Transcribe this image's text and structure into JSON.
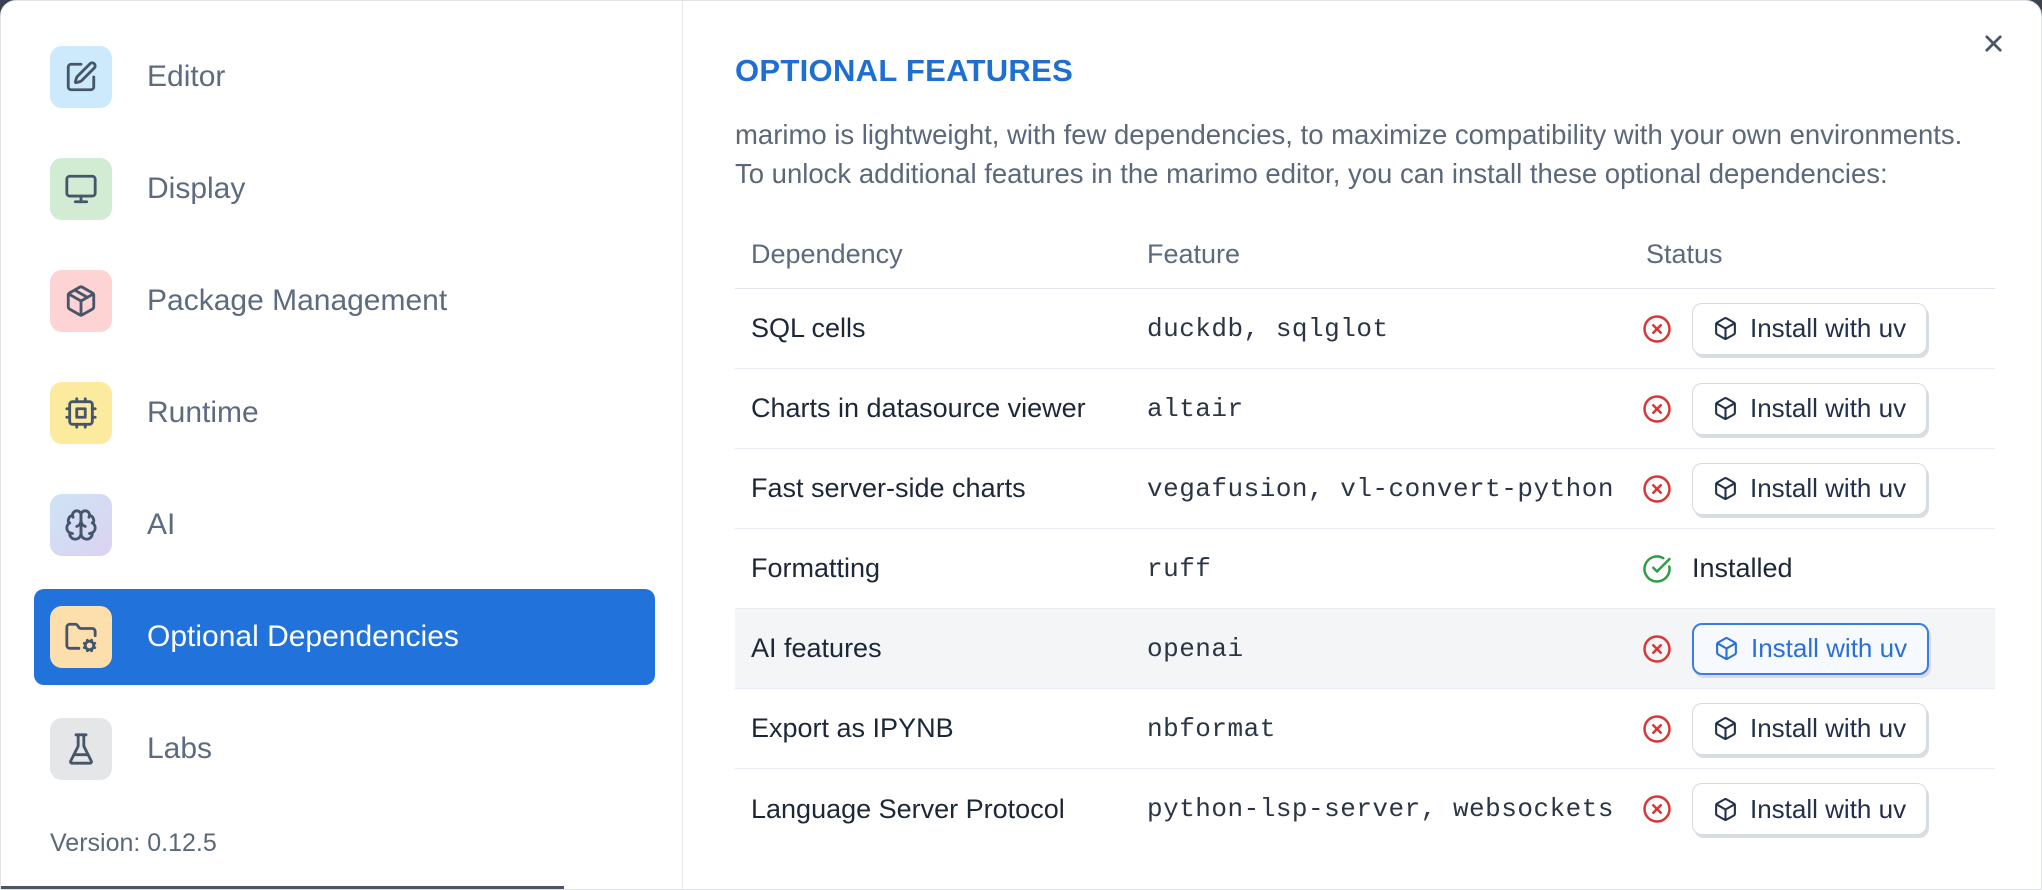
{
  "colors": {
    "accent": "#2173db",
    "title_blue": "#1d6fd2",
    "red": "#d93636",
    "green": "#2e9e44",
    "row_highlight": "#f4f5f7",
    "sidebar_border": "#e4e7ec"
  },
  "sidebar": {
    "items": [
      {
        "label": "Editor",
        "icon": "square-pen",
        "tile_color": "#cde9fc",
        "selected": false
      },
      {
        "label": "Display",
        "icon": "monitor",
        "tile_color": "#d2ecd3",
        "selected": false
      },
      {
        "label": "Package Management",
        "icon": "package",
        "tile_color": "#fdd3d4",
        "selected": false
      },
      {
        "label": "Runtime",
        "icon": "cpu",
        "tile_color": "#fcea9f",
        "selected": false
      },
      {
        "label": "AI",
        "icon": "brain",
        "tile_color": "linear-gradient(135deg,#cde4f6,#dcd2ef)",
        "selected": false
      },
      {
        "label": "Optional Dependencies",
        "icon": "folder-cog",
        "tile_color": "#fcdfad",
        "selected": true
      },
      {
        "label": "Labs",
        "icon": "flask-conical",
        "tile_color": "#e5e6e8",
        "selected": false
      }
    ],
    "version_label": "Version: 0.12.5"
  },
  "main": {
    "title": "OPTIONAL FEATURES",
    "close_icon": "x",
    "description_lines": [
      "marimo is lightweight, with few dependencies, to maximize compatibility with your own environments.",
      "To unlock additional features in the marimo editor, you can install these optional dependencies:"
    ],
    "table": {
      "columns": [
        "Dependency",
        "Feature",
        "Status"
      ],
      "rows": [
        {
          "dependency": "SQL cells",
          "feature": "duckdb, sqlglot",
          "installed": false,
          "action_label": "Install with uv",
          "highlighted": false
        },
        {
          "dependency": "Charts in datasource viewer",
          "feature": "altair",
          "installed": false,
          "action_label": "Install with uv",
          "highlighted": false
        },
        {
          "dependency": "Fast server-side charts",
          "feature": "vegafusion, vl-convert-python",
          "installed": false,
          "action_label": "Install with uv",
          "highlighted": false
        },
        {
          "dependency": "Formatting",
          "feature": "ruff",
          "installed": true,
          "status_text": "Installed",
          "highlighted": false
        },
        {
          "dependency": "AI features",
          "feature": "openai",
          "installed": false,
          "action_label": "Install with uv",
          "highlighted": true
        },
        {
          "dependency": "Export as IPYNB",
          "feature": "nbformat",
          "installed": false,
          "action_label": "Install with uv",
          "highlighted": false
        },
        {
          "dependency": "Language Server Protocol",
          "feature": "python-lsp-server, websockets",
          "installed": false,
          "action_label": "Install with uv",
          "highlighted": false
        }
      ]
    }
  }
}
